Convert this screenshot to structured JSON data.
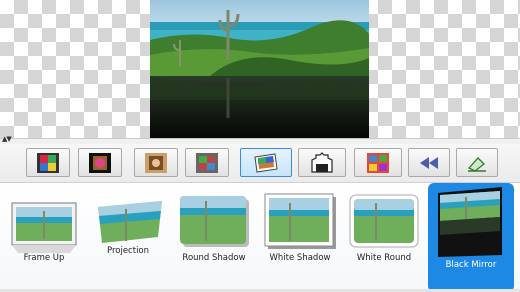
{
  "preview": {
    "image": "landscape-photo-with-mirror-reflection"
  },
  "toolbar": {
    "buttons": [
      {
        "icon": "color-frame-icon"
      },
      {
        "icon": "dark-frame-icon"
      },
      {
        "icon": "sepia-frame-icon"
      },
      {
        "icon": "stamp-frame-icon"
      },
      {
        "icon": "tilted-photo-icon",
        "selected": true
      },
      {
        "icon": "torn-edge-icon"
      },
      {
        "icon": "grid-frame-icon"
      },
      {
        "icon": "rewind-icon"
      },
      {
        "icon": "apply-style-icon"
      }
    ]
  },
  "gallery": {
    "items": [
      {
        "label": "Frame Up"
      },
      {
        "label": "Projection"
      },
      {
        "label": "Round Shadow"
      },
      {
        "label": "White Shadow"
      },
      {
        "label": "White Round"
      },
      {
        "label": "Black Mirror",
        "selected": true
      }
    ]
  },
  "colors": {
    "accent": "#1e88e5",
    "selected_button": "#c6e4fa"
  }
}
